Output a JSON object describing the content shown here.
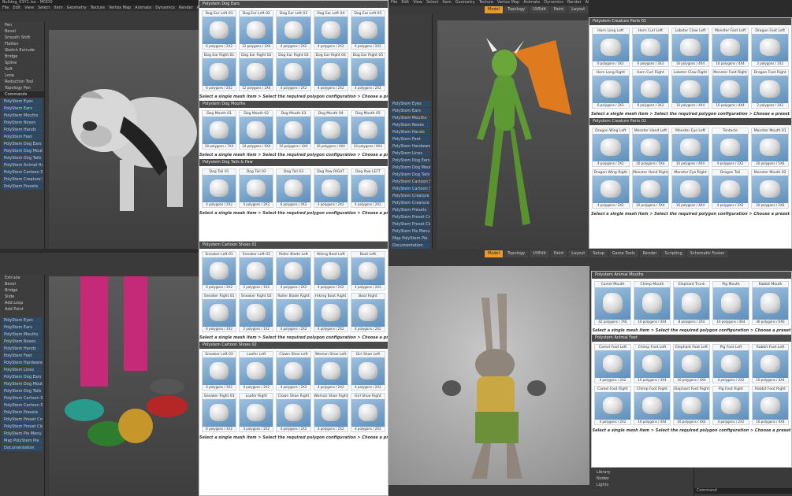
{
  "q1": {
    "title": "Bulldog_03Y1.lxo - MODO",
    "menu": [
      "File",
      "Edit",
      "View",
      "Select",
      "Item",
      "Geometry",
      "Texture",
      "Vertex Map",
      "Animate",
      "Dynamics",
      "Render",
      "ACS",
      "Layout",
      "System",
      "Help"
    ],
    "tools": [
      "Pen",
      "Bevel",
      "Smooth Shift",
      "Flatten",
      "Sketch Extrude",
      "Bridge",
      "Spline",
      "Soft",
      "Loop",
      "Reduction Tool",
      "Topology Pen"
    ],
    "commands": "Commands",
    "list": [
      "PolyStem Eyes",
      "PolyStem Ears",
      "PolyStem Mouths",
      "PolyStem Noses",
      "PolyStem Hands",
      "PolyStem Feet",
      "PolyStem Dog Ears",
      "PolyStem Dog Mouths",
      "PolyStem Dog Tails & Paw",
      "PolyStem Animal Heads",
      "PolyStem Cartoon Shoes 01",
      "PolyStem Creature Parts 01",
      "PolyStem Presets"
    ]
  },
  "p1": {
    "sections": [
      {
        "title": "Polystem Dog Ears",
        "items": [
          [
            "Dog Ear Left 01",
            "6 polygons / 2X2"
          ],
          [
            "Dog Ear Left 02",
            "12 polygons / 2X4"
          ],
          [
            "Dog Ear Left 03",
            "4 polygons / 2X2"
          ],
          [
            "Dog Ear Left 04",
            "4 polygons / 2X2"
          ],
          [
            "Dog Ear Left 05",
            "4 polygons / 2X2"
          ],
          [
            "Dog Ear Right 01",
            "6 polygons / 2X2"
          ],
          [
            "Dog Ear Right 02",
            "12 polygons / 2X4"
          ],
          [
            "Dog Ear Right 03",
            "4 polygons / 2X2"
          ],
          [
            "Dog Ear Right 04",
            "4 polygons / 2X2"
          ],
          [
            "Dog Ear Right 05",
            "4 polygons / 2X2"
          ]
        ]
      },
      {
        "title": "Polystem Dog Mouths",
        "items": [
          [
            "Dog Mouth 01",
            "20 polygons / 7X4"
          ],
          [
            "Dog Mouth 02",
            "24 polygons / 6X4"
          ],
          [
            "Dog Mouth 03",
            "16 polygons / 4X4"
          ],
          [
            "Dog Mouth 04",
            "16 polygons / 4X4"
          ],
          [
            "Dog Mouth 05",
            "24 polygons / 6X4"
          ]
        ]
      },
      {
        "title": "Polystem Dog Tails & Paw",
        "items": [
          [
            "Dog Tail 01",
            "4 polygons / 2X2"
          ],
          [
            "Dog Tail 02",
            "4 polygons / 2X2"
          ],
          [
            "Dog Tail 03",
            "8 polygons / 4X2"
          ],
          [
            "Dog Paw RIGHT",
            "4 polygons / 2X2"
          ],
          [
            "Dog Paw LEFT",
            "4 polygons / 2X2"
          ]
        ]
      }
    ],
    "footer": "Select a single mesh item   >   Select the required polygon configuration   >   Choose a preset"
  },
  "p2": {
    "sections": [
      {
        "title": "Polystem Creature Parts 01",
        "items": [
          [
            "Horn Long Left",
            "6 polygons / 3X3"
          ],
          [
            "Horn Curl Left",
            "6 polygons / 3X3"
          ],
          [
            "Lobster Claw Left",
            "16 polygons / 4X4"
          ],
          [
            "Monster Foot Left",
            "16 polygons / 4X4"
          ],
          [
            "Dragon Foot Left",
            "2 polygons / 1X2"
          ],
          [
            "Horn Long Right",
            "6 polygons / 3X3"
          ],
          [
            "Horn Curl Right",
            "6 polygons / 3X3"
          ],
          [
            "Lobster Claw Right",
            "16 polygons / 4X4"
          ],
          [
            "Monster Foot Right",
            "16 polygons / 4X4"
          ],
          [
            "Dragon Foot Right",
            "2 polygons / 1X2"
          ]
        ]
      },
      {
        "title": "Polystem Creature Parts 02",
        "items": [
          [
            "Dragon Wing Left",
            "4 polygons / 2X2"
          ],
          [
            "Monster Hand Left",
            "20 polygons / 5X4"
          ],
          [
            "Monster Eye Left",
            "16 polygons / 4X4"
          ],
          [
            "Tentacle",
            "4 polygons / 2X2"
          ],
          [
            "Monster Mouth 01",
            "30 polygons / 5X6"
          ],
          [
            "Dragon Wing Right",
            "4 polygons / 2X2"
          ],
          [
            "Monster Hand Right",
            "20 polygons / 5X4"
          ],
          [
            "Monster Eye Right",
            "16 polygons / 4X4"
          ],
          [
            "Dragon Tail",
            "4 polygons / 2X2"
          ],
          [
            "Monster Mouth 02",
            "30 polygons / 5X6"
          ]
        ]
      }
    ],
    "footer": "Select a single mesh item   >   Select the required polygon configuration   >   Choose a preset"
  },
  "p3": {
    "sections": [
      {
        "title": "Polystem Cartoon Shoes 01",
        "items": [
          [
            "Sneaker Left 01",
            "6 polygons / 3X2"
          ],
          [
            "Sneaker Left 02",
            "2 polygons / 1X2"
          ],
          [
            "Roller Blade Left",
            "4 polygons / 2X2"
          ],
          [
            "Hiking Boot Left",
            "4 polygons / 2X2"
          ],
          [
            "Boot Left",
            "4 polygons / 2X2"
          ],
          [
            "Sneaker Right 01",
            "6 polygons / 3X2"
          ],
          [
            "Sneaker Right 02",
            "2 polygons / 1X2"
          ],
          [
            "Roller Blade Right",
            "4 polygons / 2X2"
          ],
          [
            "Hiking Boot Right",
            "4 polygons / 2X2"
          ],
          [
            "Boot Right",
            "4 polygons / 2X2"
          ]
        ]
      },
      {
        "title": "Polystem Cartoon Shoes 02",
        "items": [
          [
            "Sneaker Left 03",
            "6 polygons / 3X2"
          ],
          [
            "Loafer Left",
            "4 polygons / 2X2"
          ],
          [
            "Clown Shoe Left",
            "4 polygons / 2X2"
          ],
          [
            "Woman Shoe Left",
            "4 polygons / 2X2"
          ],
          [
            "Girl Shoe Left",
            "4 polygons / 2X2"
          ],
          [
            "Sneaker Right 03",
            "6 polygons / 3X2"
          ],
          [
            "Loafer Right",
            "4 polygons / 2X2"
          ],
          [
            "Clown Shoe Right",
            "4 polygons / 2X2"
          ],
          [
            "Woman Shoe Right",
            "4 polygons / 2X2"
          ],
          [
            "Girl Shoe Right",
            "4 polygons / 2X2"
          ]
        ]
      }
    ],
    "footer": "Select a single mesh item   >   Select the required polygon configuration   >   Choose a preset"
  },
  "p4": {
    "sections": [
      {
        "title": "Polystem Animal Mouths",
        "items": [
          [
            "Camel Mouth",
            "42 polygons / 7X6"
          ],
          [
            "Chimp Mouth",
            "16 polygons / 4X4"
          ],
          [
            "Elephant Trunk",
            "8 polygons / 2X4"
          ],
          [
            "Pig Mouth",
            "16 polygons / 4X4"
          ],
          [
            "Rabbit Mouth",
            "36 polygons / 6X6"
          ]
        ]
      },
      {
        "title": "Polystem Animal Feet",
        "items": [
          [
            "Camel Foot Left",
            "4 polygons / 2X2"
          ],
          [
            "Chimp Foot Left",
            "16 polygons / 4X4"
          ],
          [
            "Elephant Foot Left",
            "16 polygons / 4X4"
          ],
          [
            "Pig Foot Left",
            "4 polygons / 2X2"
          ],
          [
            "Rabbit Foot Left",
            "16 polygons / 4X4"
          ],
          [
            "Camel Foot Right",
            "4 polygons / 2X2"
          ],
          [
            "Chimp Foot Right",
            "16 polygons / 4X4"
          ],
          [
            "Elephant Foot Right",
            "16 polygons / 4X4"
          ],
          [
            "Pig Foot Right",
            "4 polygons / 2X2"
          ],
          [
            "Rabbit Foot Right",
            "16 polygons / 4X4"
          ]
        ]
      }
    ],
    "footer": "Select a single mesh item   >   Select the required polygon configuration   >   Choose a preset"
  },
  "q2": {
    "menu": [
      "File",
      "Edit",
      "View",
      "Select",
      "Item",
      "Geometry",
      "Texture",
      "Vertex Map",
      "Animate",
      "Dynamics",
      "Render",
      "ACS",
      "Layout",
      "System",
      "Help"
    ],
    "tabs": [
      "Model",
      "Topology",
      "UVEdit",
      "Paint",
      "Layout",
      "Setup"
    ],
    "list": [
      "PolyStem Eyes",
      "PolyStem Ears",
      "PolyStem Mouths",
      "PolyStem Noses",
      "PolyStem Hands",
      "PolyStem Feet",
      "PolyStem Hardware",
      "PolyStem Lines",
      "PolyStem Dog Ears",
      "PolyStem Dog Mouths",
      "PolyStem Dog Tails & Paw",
      "PolyStem Cartoon Shoes 01",
      "PolyStem Cartoon Shoes 02",
      "PolyStem Creature Parts 01",
      "PolyStem Creature Parts 02",
      "PolyStem Presets",
      "PolyStem Preset Creator",
      "PolyStem Preset Cleaner",
      "PolyStem Pie Menu",
      "Map PolyStem Pie",
      "Documentation"
    ]
  },
  "q3": {
    "tools": [
      "Extrude",
      "Bevel",
      "Bridge",
      "Slide",
      "Add Loop",
      "Add Point"
    ],
    "list": [
      "PolyStem Eyes",
      "PolyStem Ears",
      "PolyStem Mouths",
      "PolyStem Noses",
      "PolyStem Hands",
      "PolyStem Feet",
      "PolyStem Hardware",
      "PolyStem Lines",
      "PolyStem Dog Ears",
      "PolyStem Dog Mouths",
      "PolyStem Dog Tails & Paw",
      "PolyStem Cartoon Shoes 01",
      "PolyStem Cartoon Shoes 02",
      "PolyStem Presets",
      "PolyStem Preset Creator",
      "PolyStem Preset Cleaner",
      "PolyStem Pie Menu",
      "Map PolyStem Pie",
      "Documentation"
    ]
  },
  "q4": {
    "tabs": [
      "Model",
      "Topology",
      "UVEdit",
      "Paint",
      "Layout",
      "Setup",
      "Game Tools",
      "Render",
      "Scripting",
      "Schematic Fusion"
    ],
    "shelf": [
      "Base Material",
      "Library",
      "Nodes",
      "Lights"
    ],
    "command": "Command"
  }
}
